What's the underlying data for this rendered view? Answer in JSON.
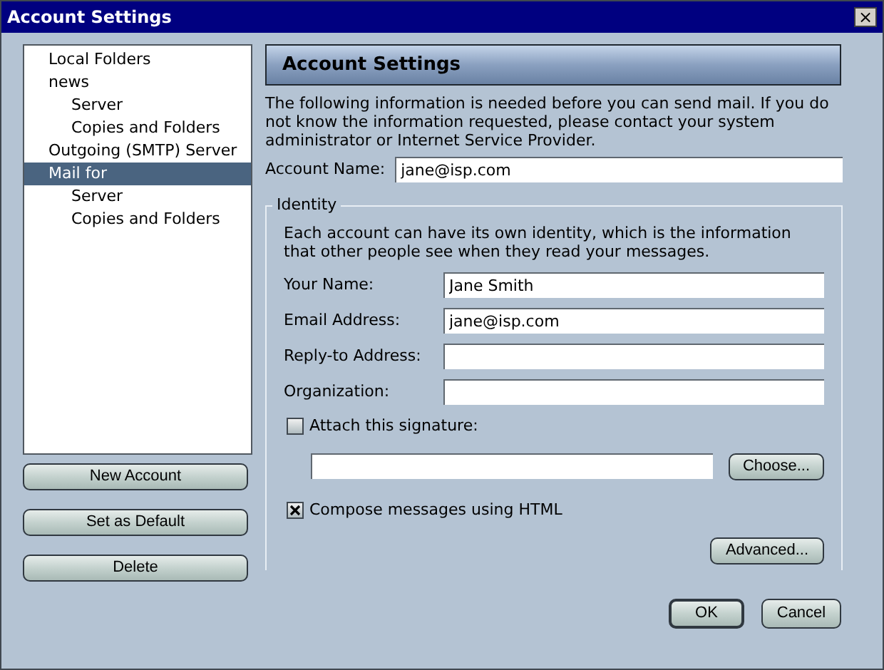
{
  "window": {
    "title": "Account Settings",
    "close": "×"
  },
  "tree": [
    {
      "label": "Local Folders",
      "selected": false
    },
    {
      "label": "news",
      "selected": false,
      "children": [
        {
          "label": "Server",
          "selected": false
        },
        {
          "label": "Copies and Folders",
          "selected": false
        }
      ]
    },
    {
      "label": "Outgoing (SMTP) Server",
      "selected": false
    },
    {
      "label": "Mail for",
      "selected": true,
      "children": [
        {
          "label": "Server",
          "selected": false
        },
        {
          "label": "Copies and Folders",
          "selected": false
        }
      ]
    }
  ],
  "side_buttons": [
    "New Account",
    "Set as Default",
    "Delete"
  ],
  "panel": {
    "heading": "Account Settings",
    "intro": "The following information is needed before you can send mail. If you do not know the information requested, please contact your system administrator or Internet Service Provider.",
    "account_name": {
      "label": "Account Name:",
      "value": "jane@isp.com"
    }
  },
  "identity": {
    "legend": "Identity",
    "description": "Each account can have its own identity, which is the information that other people see when they read your messages.",
    "fields": [
      {
        "label": "Your Name:",
        "value": "Jane Smith"
      },
      {
        "label": "Email Address:",
        "value": "jane@isp.com"
      },
      {
        "label": "Reply-to Address:"
      },
      {
        "label": "Organization:"
      }
    ],
    "signature": {
      "label": "Attach this signature:",
      "checked": false,
      "button": "Choose..."
    },
    "html": {
      "label": "Compose messages using HTML",
      "checked": true
    },
    "advanced": "Advanced..."
  },
  "buttons": [
    {
      "label": "OK",
      "default": true
    },
    {
      "label": "Cancel",
      "default": false
    }
  ]
}
